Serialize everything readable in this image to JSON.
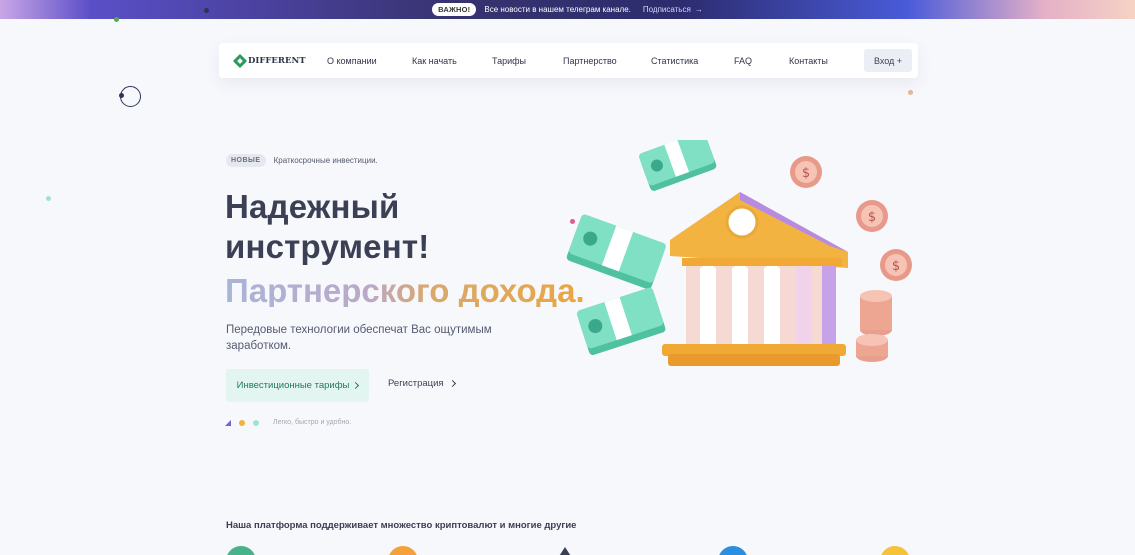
{
  "announcement": {
    "badge": "ВАЖНО!",
    "text": "Все новости в нашем телеграм канале.",
    "link": "Подписаться",
    "link_icon": "arrow-right-icon"
  },
  "nav": {
    "logo_text": "DIFFERENT",
    "items": [
      "О компании",
      "Как начать",
      "Тарифы",
      "Партнерство",
      "Статистика",
      "FAQ",
      "Контакты"
    ],
    "login_label": "Вход +"
  },
  "hero": {
    "badge": "НОВЫЕ",
    "tagline": "Краткосрочные инвестиции.",
    "title_line1": "Надежный",
    "title_line2": "инструмент!",
    "gradient_line": "Партнерского дохода.",
    "description": "Передовые технологии обеспечат Вас ощутимым заработком.",
    "primary_button": "Инвестиционные тарифы",
    "secondary_button": "Регистрация",
    "features_text": "Легко, быстро и удобно.",
    "illustration": "bank-building-with-money-and-coins"
  },
  "platform": {
    "heading": "Наша платформа поддерживает множество криптовалют и многие другие",
    "coins": [
      "coin-green-icon",
      "coin-orange-icon",
      "coin-dark-icon",
      "coin-blue-icon",
      "coin-yellow-icon"
    ]
  },
  "colors": {
    "accent_green": "#2b9b5b",
    "button_bg": "#e3f5f0",
    "gold": "#f2b23c",
    "title": "#3c4055"
  }
}
